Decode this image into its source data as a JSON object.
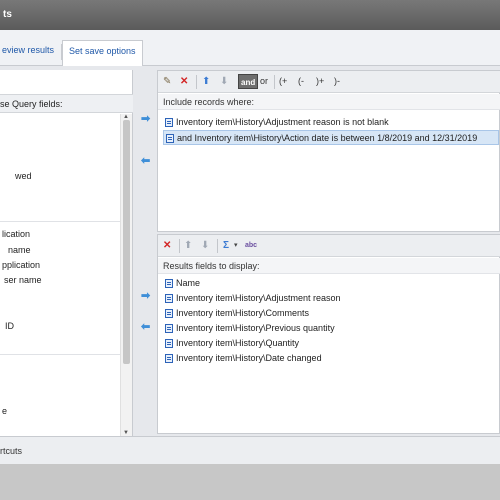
{
  "window": {
    "title": "ts"
  },
  "tabs": [
    {
      "label": "eview results"
    },
    {
      "label": "Set save options"
    }
  ],
  "left_panel": {
    "header": "se Query fields:",
    "items": [
      {
        "label": "wed"
      },
      {
        "label": "lication"
      },
      {
        "label": "name"
      },
      {
        "label": "pplication"
      },
      {
        "label": "ser name"
      },
      {
        "label": "ID"
      },
      {
        "label": "e"
      }
    ]
  },
  "filter": {
    "label": "Include records where:",
    "toolbar": {
      "and": "and",
      "or": "or",
      "paren_open_plus": "(+",
      "paren_open_minus": "(-",
      "paren_close_plus": ")+",
      "paren_close_minus": ")-"
    },
    "rows": [
      {
        "text": "Inventory item\\History\\Adjustment reason is not blank"
      },
      {
        "text": "and Inventory item\\History\\Action date is between 1/8/2019 and 12/31/2019"
      }
    ]
  },
  "results": {
    "label": "Results fields to display:",
    "toolbar": {
      "sigma": "Σ",
      "abc": "abc"
    },
    "rows": [
      {
        "text": "Name"
      },
      {
        "text": "Inventory item\\History\\Adjustment reason"
      },
      {
        "text": "Inventory item\\History\\Comments"
      },
      {
        "text": "Inventory item\\History\\Previous quantity"
      },
      {
        "text": "Inventory item\\History\\Quantity"
      },
      {
        "text": "Inventory item\\History\\Date changed"
      }
    ]
  },
  "bottom": {
    "shortcuts": "rtcuts"
  }
}
